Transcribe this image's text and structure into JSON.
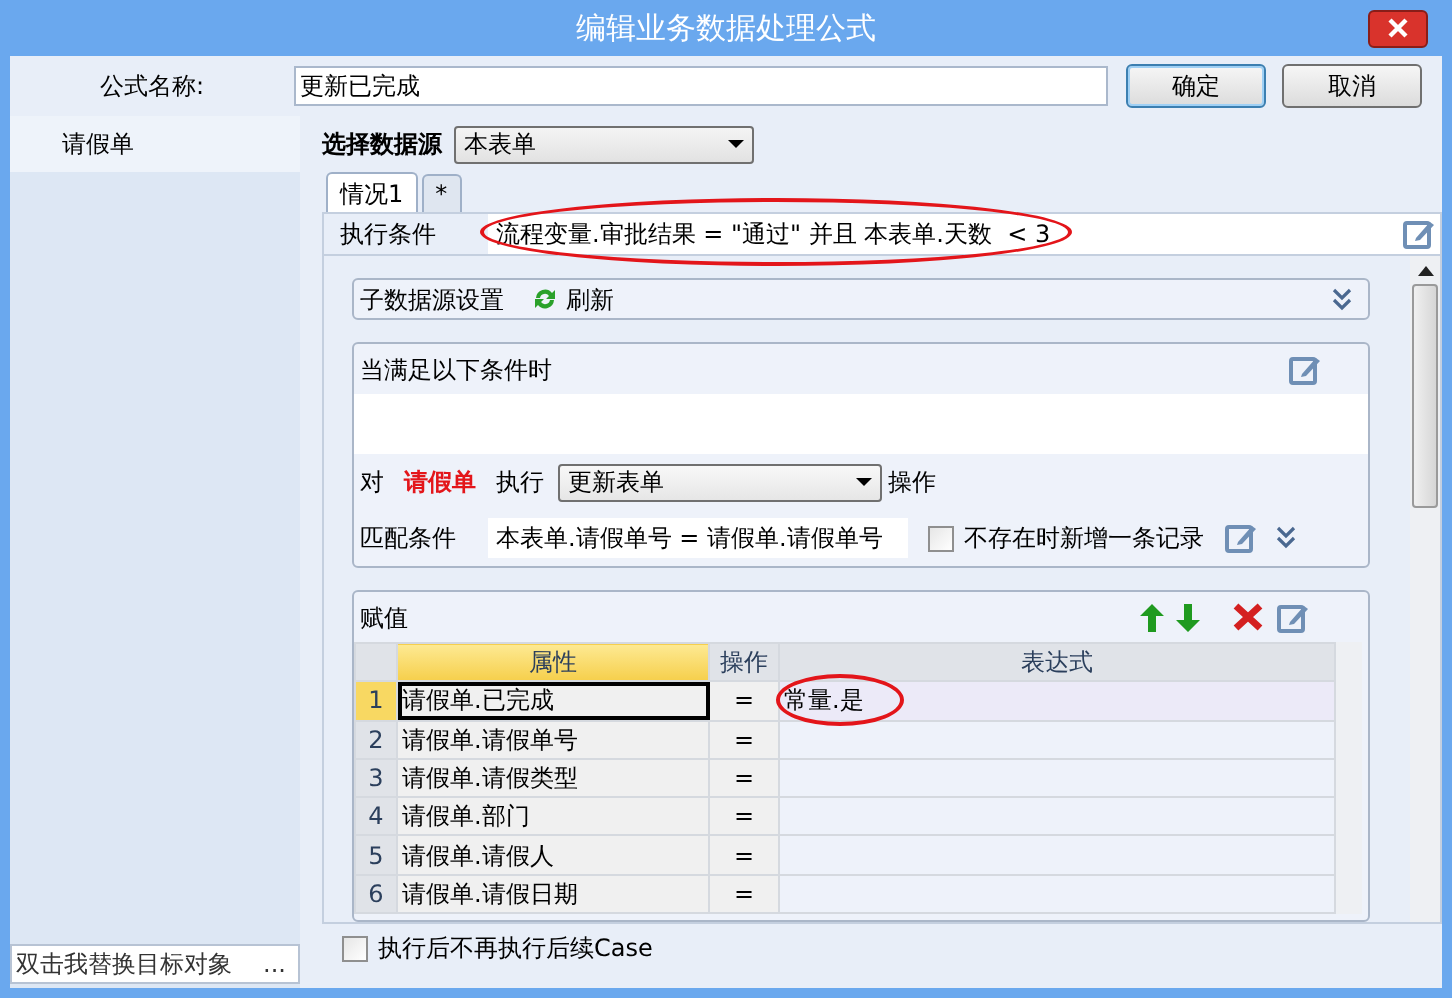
{
  "window": {
    "title": "编辑业务数据处理公式"
  },
  "formula_name": {
    "label": "公式名称:",
    "value": "更新已完成"
  },
  "buttons": [
    {
      "label": "确定",
      "kind": "default"
    },
    {
      "label": "取消",
      "kind": "normal"
    }
  ],
  "sidebar": {
    "items": [
      {
        "label": "请假单",
        "selected": true
      }
    ],
    "target_field": {
      "value": "双击我替换目标对象",
      "button": "..."
    }
  },
  "data_source": {
    "label": "选择数据源",
    "value": "本表单"
  },
  "tabs": [
    {
      "label": "情况1",
      "selected": true
    },
    {
      "label": "*",
      "selected": false
    }
  ],
  "condition": {
    "label": "执行条件",
    "value": "流程变量.审批结果 = \"通过\" 并且 本表单.天数  < 3",
    "circled": true
  },
  "sub_source": {
    "label": "子数据源设置",
    "refresh": "刷新"
  },
  "when": {
    "label": "当满足以下条件时",
    "target_prefix": "对",
    "target": "请假单",
    "exec_label": "执行",
    "action": "更新表单",
    "action_suffix": "操作",
    "match_label": "匹配条件",
    "match_value": "本表单.请假单号 = 请假单.请假单号",
    "add_if_missing": {
      "label": "不存在时新增一条记录",
      "checked": false
    }
  },
  "assign": {
    "label": "赋值",
    "columns": [
      "属性",
      "操作",
      "表达式"
    ],
    "rows": [
      {
        "index": "1",
        "property": "请假单.已完成",
        "op": "=",
        "expression": "常量.是",
        "selected": true,
        "circled": true
      },
      {
        "index": "2",
        "property": "请假单.请假单号",
        "op": "=",
        "selected": false,
        "circled": false
      },
      {
        "index": "3",
        "property": "请假单.请假类型",
        "op": "=",
        "selected": false,
        "circled": false
      },
      {
        "index": "4",
        "property": "请假单.部门",
        "op": "=",
        "selected": false,
        "circled": false
      },
      {
        "index": "5",
        "property": "请假单.请假人",
        "op": "=",
        "selected": false,
        "circled": false
      },
      {
        "index": "6",
        "property": "请假单.请假日期",
        "op": "=",
        "selected": false,
        "circled": false
      }
    ]
  },
  "stop_after": {
    "label": "执行后不再执行后续Case",
    "checked": false
  }
}
